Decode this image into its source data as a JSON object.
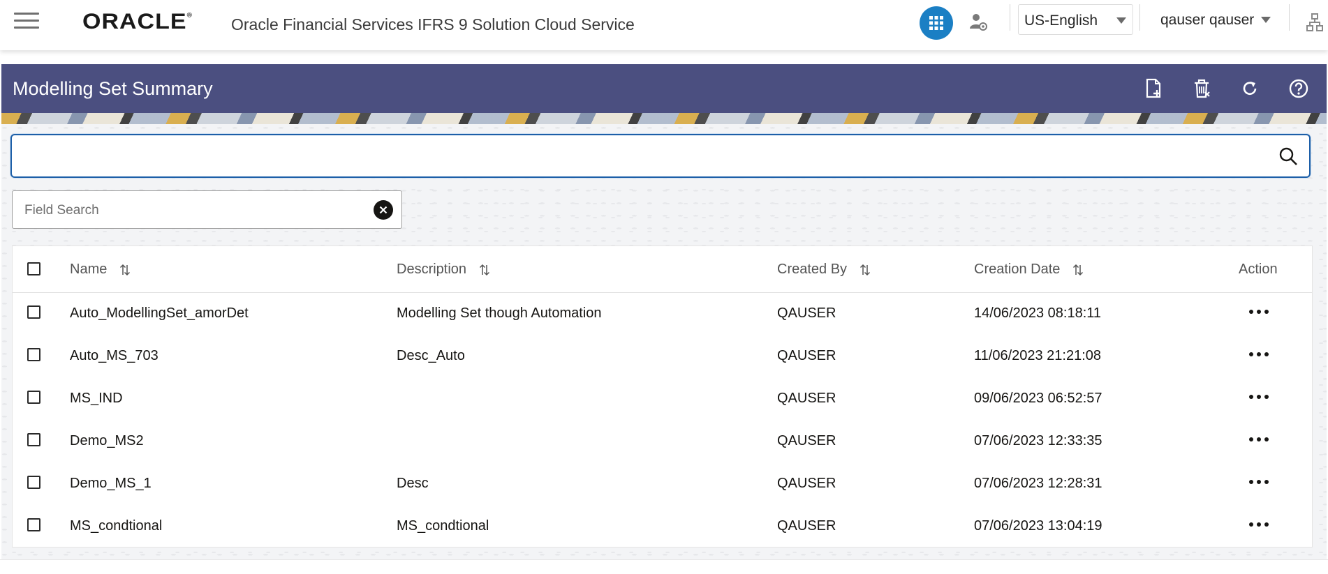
{
  "header": {
    "logo": "ORACLE",
    "logo_mark": "®",
    "app_title": "Oracle Financial Services IFRS 9 Solution Cloud Service",
    "language": "US-English",
    "user": "qauser qauser",
    "icons": [
      "hamburger-menu-icon",
      "apps-grid-icon",
      "user-admin-icon",
      "hierarchy-icon"
    ],
    "accent_color": "#1b7fc4"
  },
  "page": {
    "title": "Modelling Set Summary",
    "title_bar_color": "#4b4f80",
    "toolbar_icons": [
      "add-document-icon",
      "delete-icon",
      "refresh-icon",
      "help-icon"
    ]
  },
  "search": {
    "value": "",
    "field_search_placeholder": "Field Search"
  },
  "table": {
    "columns": [
      "Name",
      "Description",
      "Created By",
      "Creation Date",
      "Action"
    ],
    "rows": [
      {
        "name": "Auto_ModellingSet_amorDet",
        "description": "Modelling Set though Automation",
        "created_by": "QAUSER",
        "creation_date": "14/06/2023 08:18:11"
      },
      {
        "name": "Auto_MS_703",
        "description": "Desc_Auto",
        "created_by": "QAUSER",
        "creation_date": "11/06/2023 21:21:08"
      },
      {
        "name": "MS_IND",
        "description": "",
        "created_by": "QAUSER",
        "creation_date": "09/06/2023 06:52:57"
      },
      {
        "name": "Demo_MS2",
        "description": "",
        "created_by": "QAUSER",
        "creation_date": "07/06/2023 12:33:35"
      },
      {
        "name": "Demo_MS_1",
        "description": "Desc",
        "created_by": "QAUSER",
        "creation_date": "07/06/2023 12:28:31"
      },
      {
        "name": "MS_condtional",
        "description": "MS_condtional",
        "created_by": "QAUSER",
        "creation_date": "07/06/2023 13:04:19"
      }
    ]
  }
}
